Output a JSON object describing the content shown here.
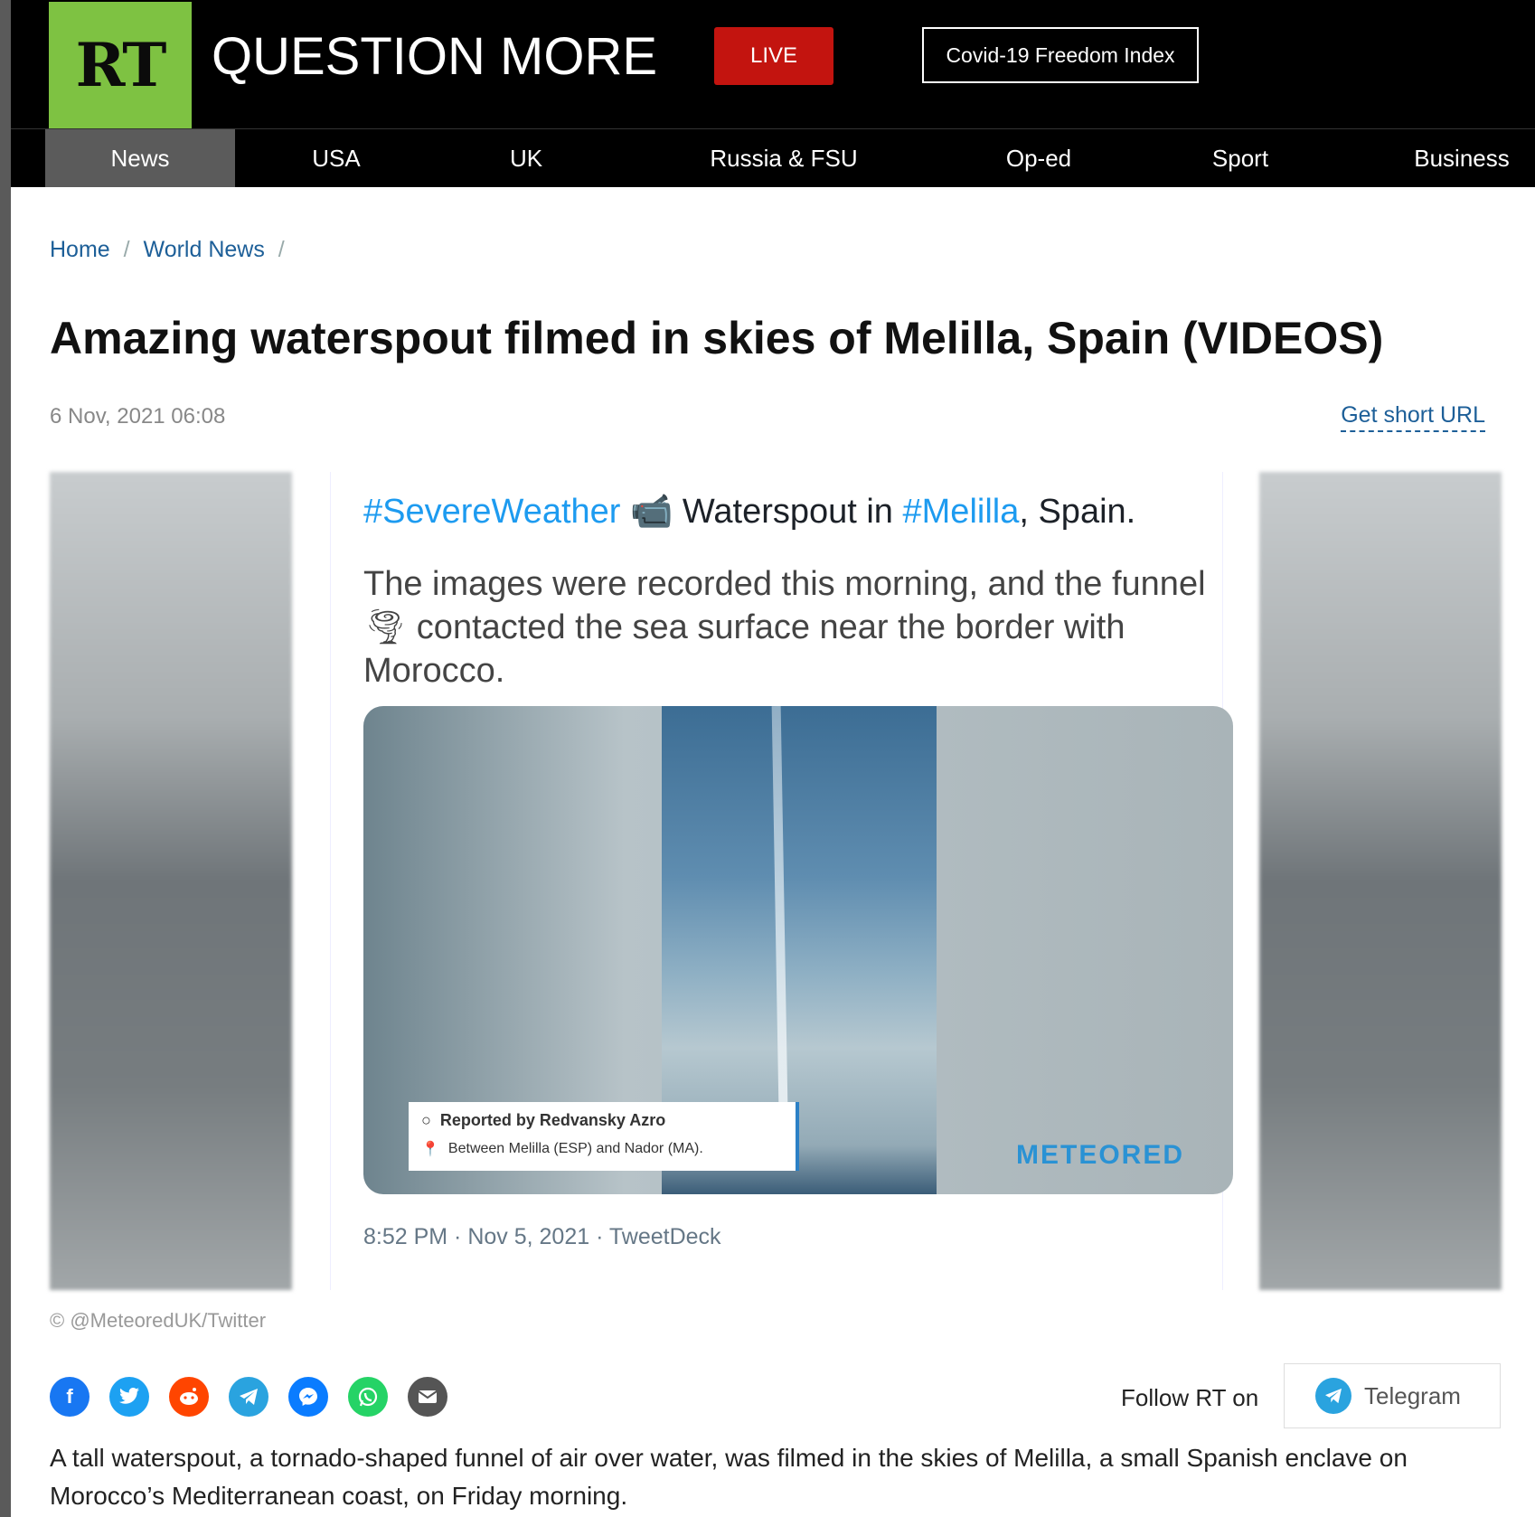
{
  "header": {
    "logo_text": "RT",
    "tagline": "QUESTION MORE",
    "live_label": "LIVE",
    "covid_label": "Covid-19 Freedom Index"
  },
  "nav": {
    "items": [
      {
        "label": "News",
        "active": true
      },
      {
        "label": "USA"
      },
      {
        "label": "UK"
      },
      {
        "label": "Russia & FSU"
      },
      {
        "label": "Op-ed"
      },
      {
        "label": "Sport"
      },
      {
        "label": "Business"
      }
    ]
  },
  "breadcrumb": {
    "home": "Home",
    "section": "World News",
    "separator": "/"
  },
  "article": {
    "headline": "Amazing waterspout filmed in skies of Melilla, Spain (VIDEOS)",
    "date": "6 Nov, 2021 06:08",
    "short_url_label": "Get short URL",
    "credit": "© @MeteoredUK/Twitter",
    "body": "A tall waterspout, a tornado-shaped funnel of air over water, was filmed in the skies of Melilla, a small Spanish enclave on Morocco’s Mediterranean coast, on Friday morning."
  },
  "tweet": {
    "hashtag1": "#SevereWeather",
    "camera_emoji": "📹",
    "text1": " Waterspout in ",
    "hashtag2": "#Melilla",
    "text2": ", Spain.",
    "body_part1": "The images were recorded this morning, and the funnel",
    "tornado_emoji": "🌪",
    "body_part2": " contacted the sea surface near the border with Morocco.",
    "video_report_line1": "Reported by Redvansky Azro",
    "video_report_line2": "Between Melilla (ESP) and Nador (MA).",
    "video_watermark": "METEORED",
    "meta": "8:52 PM · Nov 5, 2021 · TweetDeck"
  },
  "share": {
    "icons": [
      "facebook-icon",
      "twitter-icon",
      "reddit-icon",
      "telegram-icon",
      "messenger-icon",
      "whatsapp-icon",
      "email-icon"
    ],
    "colors": {
      "facebook": "#1877f2",
      "twitter": "#1da1f2",
      "reddit": "#ff4500",
      "telegram": "#2aa3df",
      "messenger": "#0a7cff",
      "whatsapp": "#25d366",
      "email": "#555555"
    }
  },
  "follow": {
    "label": "Follow RT on",
    "telegram_label": "Telegram"
  },
  "colors": {
    "brand_green": "#7ec242",
    "live_red": "#c3140f",
    "link_blue": "#1d5f98",
    "tweet_blue": "#1d9bf0"
  }
}
